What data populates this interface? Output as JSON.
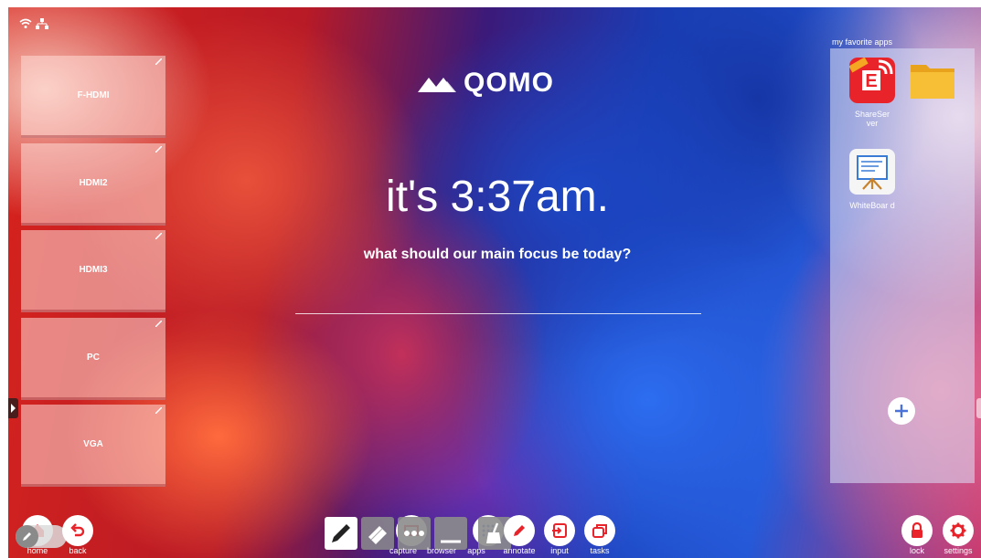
{
  "colors": {
    "accent": "#e8232a",
    "white": "#ffffff"
  },
  "logo": {
    "text": "QOMO"
  },
  "clock": {
    "text": "it's 3:37am."
  },
  "focus": {
    "question": "what should our main focus be today?",
    "input_value": ""
  },
  "sources": [
    {
      "label": "F-HDMI"
    },
    {
      "label": "HDMI2"
    },
    {
      "label": "HDMI3"
    },
    {
      "label": "PC"
    },
    {
      "label": "VGA"
    }
  ],
  "favorites": {
    "title": "my favorite apps",
    "apps": [
      {
        "label": "ShareSer ver",
        "icon": "shareserver-icon"
      },
      {
        "label": "",
        "icon": "folder-icon"
      },
      {
        "label": "WhiteBoar d",
        "icon": "whiteboard-icon"
      }
    ]
  },
  "bottom": {
    "home": "home",
    "back": "back",
    "capture": "capture",
    "browser": "browser",
    "apps": "apps",
    "annotate": "annotate",
    "input": "input",
    "tasks": "tasks",
    "lock": "lock",
    "settings": "settings"
  }
}
